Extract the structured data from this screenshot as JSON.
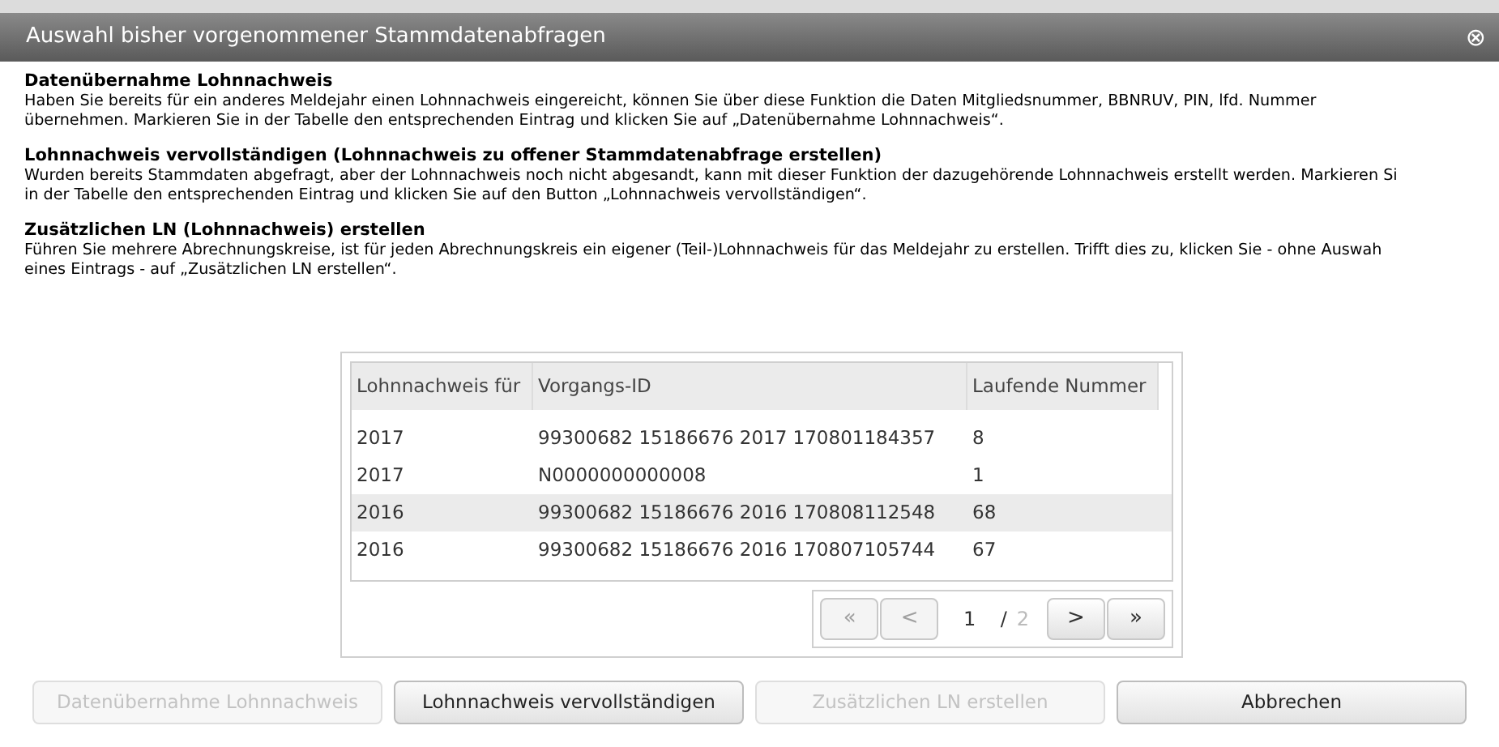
{
  "window": {
    "title": "Auswahl bisher vorgenommener Stammdatenabfragen",
    "close": "⊗"
  },
  "sections": [
    {
      "heading": "Datenübernahme Lohnnachweis",
      "lines": [
        "Haben Sie bereits für ein anderes Meldejahr einen Lohnnachweis eingereicht, können Sie über diese Funktion die Daten Mitgliedsnummer, BBNRUV, PIN, lfd. Nummer",
        "übernehmen. Markieren Sie in der Tabelle den entsprechenden Eintrag und klicken Sie auf „Datenübernahme Lohnnachweis“."
      ]
    },
    {
      "heading": "Lohnnachweis vervollständigen (Lohnnachweis zu offener Stammdatenabfrage erstellen)",
      "lines": [
        "Wurden bereits Stammdaten abgefragt, aber der Lohnnachweis noch nicht abgesandt, kann mit dieser Funktion der dazugehörende Lohnnachweis erstellt werden. Markieren Si",
        "in der Tabelle den entsprechenden Eintrag und klicken Sie auf den Button „Lohnnachweis vervollständigen“."
      ]
    },
    {
      "heading": "Zusätzlichen LN (Lohnnachweis) erstellen",
      "lines": [
        "Führen Sie mehrere Abrechnungskreise, ist für jeden Abrechnungskreis ein eigener (Teil-)Lohnnachweis für das Meldejahr zu erstellen. Trifft dies zu, klicken Sie - ohne Auswah",
        "eines Eintrags - auf „Zusätzlichen LN erstellen“."
      ]
    }
  ],
  "table": {
    "columns": [
      "Lohnnachweis für",
      "Vorgangs-ID",
      "Laufende Nummer"
    ],
    "rows": [
      {
        "cells": [
          "2017",
          "99300682 15186676 2017 170801184357",
          "8"
        ],
        "selected": false
      },
      {
        "cells": [
          "2017",
          "N0000000000008",
          "1"
        ],
        "selected": false
      },
      {
        "cells": [
          "2016",
          "99300682 15186676 2016 170808112548",
          "68"
        ],
        "selected": true
      },
      {
        "cells": [
          "2016",
          "99300682 15186676 2016 170807105744",
          "67"
        ],
        "selected": false
      }
    ]
  },
  "pager": {
    "buttons": [
      {
        "label": "«",
        "disabled": true
      },
      {
        "label": "<",
        "disabled": true
      }
    ],
    "page": "1",
    "separator": "/",
    "total": "2",
    "next_buttons": [
      {
        "label": ">",
        "disabled": false
      },
      {
        "label": "»",
        "disabled": false
      }
    ]
  },
  "buttons": [
    {
      "label": "Datenübernahme Lohnnachweis",
      "disabled": true
    },
    {
      "label": "Lohnnachweis vervollständigen",
      "disabled": false
    },
    {
      "label": "Zusätzlichen LN erstellen",
      "disabled": true
    },
    {
      "label": "Abbrechen",
      "disabled": false
    }
  ]
}
